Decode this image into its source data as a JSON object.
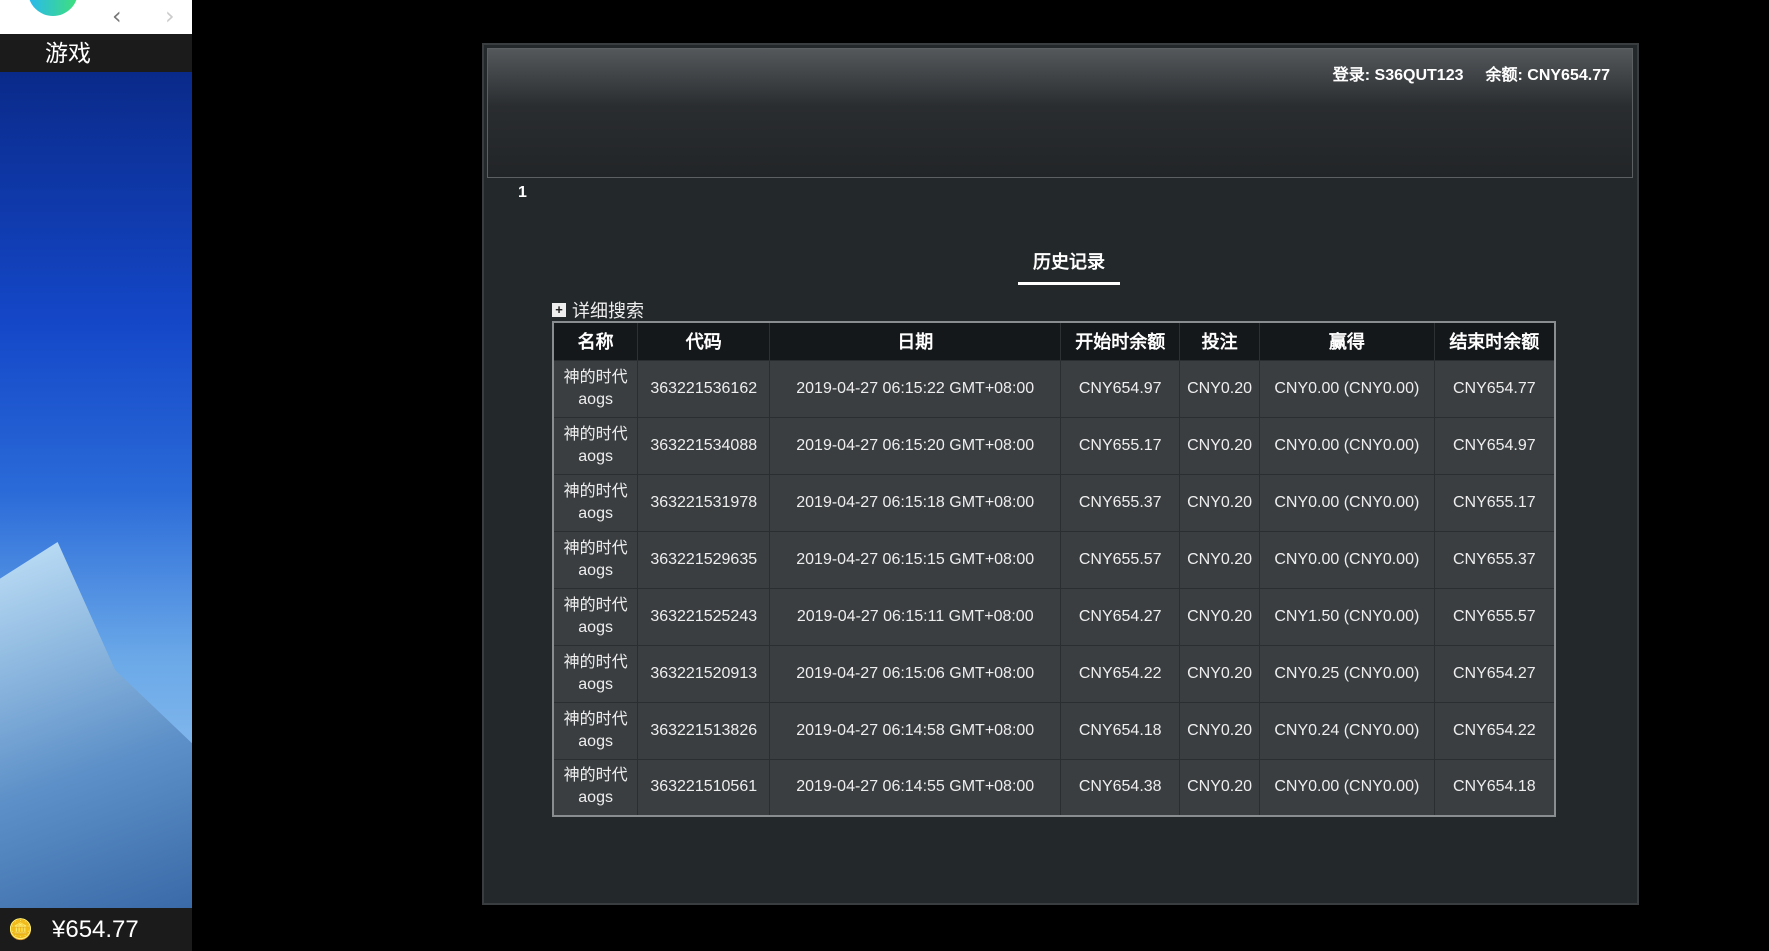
{
  "sidebar": {
    "nav_back": "‹",
    "nav_forward": "›",
    "games_label": "游戏",
    "wallet_balance": "¥654.77",
    "wallet_icon": "coins-icon"
  },
  "header": {
    "login": "登录: S36QUT123",
    "balance": "余额: CNY654.77"
  },
  "page_number": "1",
  "section_title": "历史记录",
  "advanced_search": "详细搜索",
  "table": {
    "columns": [
      "名称",
      "代码",
      "日期",
      "开始时余额",
      "投注",
      "赢得",
      "结束时余额"
    ],
    "rows": [
      {
        "name": "神的时代",
        "name2": "aogs",
        "code": "363221536162",
        "date": "2019-04-27 06:15:22 GMT+08:00",
        "start": "CNY654.97",
        "bet": "CNY0.20",
        "win": "CNY0.00 (CNY0.00)",
        "end": "CNY654.77"
      },
      {
        "name": "神的时代",
        "name2": "aogs",
        "code": "363221534088",
        "date": "2019-04-27 06:15:20 GMT+08:00",
        "start": "CNY655.17",
        "bet": "CNY0.20",
        "win": "CNY0.00 (CNY0.00)",
        "end": "CNY654.97"
      },
      {
        "name": "神的时代",
        "name2": "aogs",
        "code": "363221531978",
        "date": "2019-04-27 06:15:18 GMT+08:00",
        "start": "CNY655.37",
        "bet": "CNY0.20",
        "win": "CNY0.00 (CNY0.00)",
        "end": "CNY655.17"
      },
      {
        "name": "神的时代",
        "name2": "aogs",
        "code": "363221529635",
        "date": "2019-04-27 06:15:15 GMT+08:00",
        "start": "CNY655.57",
        "bet": "CNY0.20",
        "win": "CNY0.00 (CNY0.00)",
        "end": "CNY655.37"
      },
      {
        "name": "神的时代",
        "name2": "aogs",
        "code": "363221525243",
        "date": "2019-04-27 06:15:11 GMT+08:00",
        "start": "CNY654.27",
        "bet": "CNY0.20",
        "win": "CNY1.50 (CNY0.00)",
        "end": "CNY655.57"
      },
      {
        "name": "神的时代",
        "name2": "aogs",
        "code": "363221520913",
        "date": "2019-04-27 06:15:06 GMT+08:00",
        "start": "CNY654.22",
        "bet": "CNY0.20",
        "win": "CNY0.25 (CNY0.00)",
        "end": "CNY654.27"
      },
      {
        "name": "神的时代",
        "name2": "aogs",
        "code": "363221513826",
        "date": "2019-04-27 06:14:58 GMT+08:00",
        "start": "CNY654.18",
        "bet": "CNY0.20",
        "win": "CNY0.24 (CNY0.00)",
        "end": "CNY654.22"
      },
      {
        "name": "神的时代",
        "name2": "aogs",
        "code": "363221510561",
        "date": "2019-04-27 06:14:55 GMT+08:00",
        "start": "CNY654.38",
        "bet": "CNY0.20",
        "win": "CNY0.00 (CNY0.00)",
        "end": "CNY654.18"
      }
    ]
  }
}
